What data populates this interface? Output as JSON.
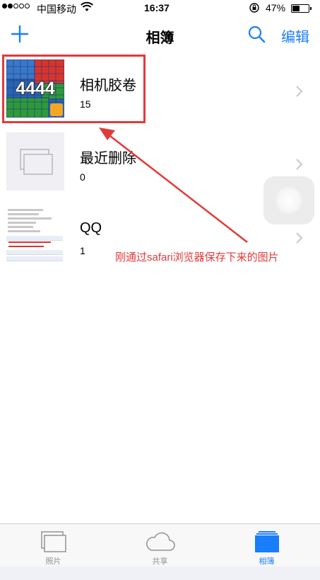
{
  "status_bar": {
    "carrier": "中国移动",
    "time": "16:37",
    "battery_percent": "47%",
    "battery_level": 0.47,
    "signal_bars_filled": 2,
    "signal_bars_total": 5,
    "icons": [
      "signal-dots-icon",
      "wifi-icon",
      "rotation-lock-icon",
      "battery-icon"
    ]
  },
  "navbar": {
    "title": "相簿",
    "edit_label": "编辑",
    "icons": [
      "plus-icon",
      "search-icon"
    ],
    "accent_color": "#1a7dfa"
  },
  "albums": [
    {
      "name": "相机胶卷",
      "count": "15",
      "thumb_text": "4444"
    },
    {
      "name": "最近删除",
      "count": "0"
    },
    {
      "name": "QQ",
      "count": "1"
    }
  ],
  "annotation": {
    "text": "刚通过safari浏览器保存下来的图片",
    "color": "#e23a3a"
  },
  "tabbar": {
    "tabs": [
      {
        "label": "照片",
        "icon": "photos-icon",
        "active": false
      },
      {
        "label": "共享",
        "icon": "cloud-icon",
        "active": false
      },
      {
        "label": "相簿",
        "icon": "albums-icon",
        "active": true
      }
    ]
  }
}
